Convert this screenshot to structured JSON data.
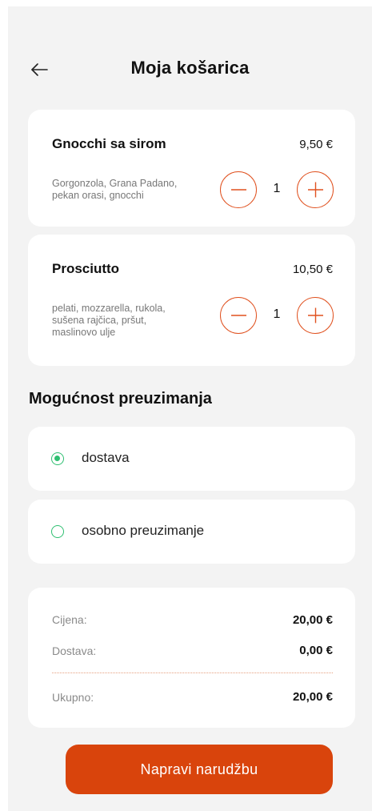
{
  "header": {
    "title": "Moja košarica",
    "back_icon": "arrow-left-icon"
  },
  "cart": {
    "items": [
      {
        "name": "Gnocchi sa sirom",
        "price": "9,50 €",
        "description_lines": [
          "Gorgonzola, Grana Padano,",
          "pekan orasi, gnocchi"
        ],
        "quantity": "1"
      },
      {
        "name": "Prosciutto",
        "price": "10,50 €",
        "description_lines": [
          "pelati, mozzarella, rukola,",
          "sušena rajčica, pršut,",
          "maslinovo ulje"
        ],
        "quantity": "1"
      }
    ]
  },
  "pickup": {
    "title": "Mogućnost preuzimanja",
    "options": [
      {
        "label": "dostava",
        "selected": true
      },
      {
        "label": "osobno preuzimanje",
        "selected": false
      }
    ]
  },
  "summary": {
    "price_label": "Cijena:",
    "price_value": "20,00 €",
    "delivery_label": "Dostava:",
    "delivery_value": "0,00 €",
    "total_label": "Ukupno:",
    "total_value": "20,00 €"
  },
  "order_button": {
    "label": "Napravi narudžbu"
  },
  "colors": {
    "accent": "#d9440c",
    "stepper_border": "#e0511f",
    "radio": "#2fbf71",
    "background": "#f3f3f3"
  }
}
